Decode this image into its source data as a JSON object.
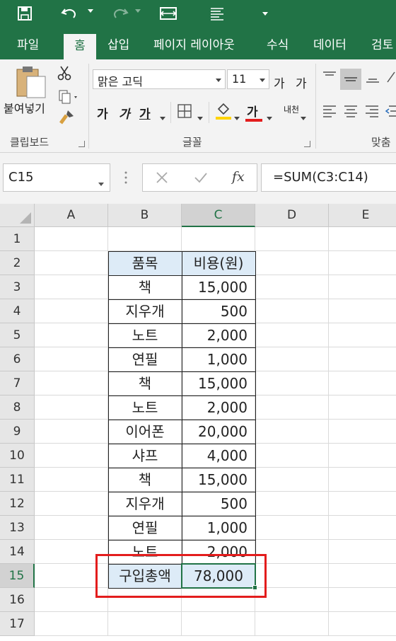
{
  "quick_access": {
    "save_icon": "save-icon",
    "undo_icon": "undo-icon",
    "redo_icon": "redo-icon",
    "touch_mode_icon": "touch-mode-icon",
    "form_icon": "form-icon",
    "customize_icon": "customize-toolbar-icon"
  },
  "tabs": [
    "파일",
    "홈",
    "삽입",
    "페이지 레이아웃",
    "수식",
    "데이터",
    "검토"
  ],
  "active_tab": "홈",
  "ribbon": {
    "clipboard": {
      "paste_label": "붙여넣기",
      "group_label": "클립보드"
    },
    "font": {
      "font_name": "맑은 고딕",
      "font_size": "11",
      "increase_size": "가",
      "decrease_size": "가",
      "bold": "가",
      "italic": "가",
      "underline": "가",
      "font_color_glyph": "가",
      "phonetic": "내천",
      "group_label": "글꼴"
    },
    "alignment": {
      "group_label": "맞춤"
    }
  },
  "formula_bar": {
    "name_box": "C15",
    "cancel_icon": "cancel-icon",
    "enter_icon": "check-icon",
    "fx_label": "fx",
    "formula": "=SUM(C3:C14)"
  },
  "columns": [
    "A",
    "B",
    "C",
    "D",
    "E"
  ],
  "rows": [
    "1",
    "2",
    "3",
    "4",
    "5",
    "6",
    "7",
    "8",
    "9",
    "10",
    "11",
    "12",
    "13",
    "14",
    "15",
    "16",
    "17"
  ],
  "selected_cell": "C15",
  "table": {
    "header": [
      "품목",
      "비용(원)"
    ],
    "rows": [
      [
        "책",
        "15,000"
      ],
      [
        "지우개",
        "500"
      ],
      [
        "노트",
        "2,000"
      ],
      [
        "연필",
        "1,000"
      ],
      [
        "책",
        "15,000"
      ],
      [
        "노트",
        "2,000"
      ],
      [
        "이어폰",
        "20,000"
      ],
      [
        "샤프",
        "4,000"
      ],
      [
        "책",
        "15,000"
      ],
      [
        "지우개",
        "500"
      ],
      [
        "연필",
        "1,000"
      ],
      [
        "노트",
        "2,000"
      ]
    ],
    "total": [
      "구입총액",
      "78,000"
    ]
  },
  "colors": {
    "excel_green": "#217346",
    "header_fill": "#ddebf7",
    "highlight_box": "#e31d1d"
  }
}
